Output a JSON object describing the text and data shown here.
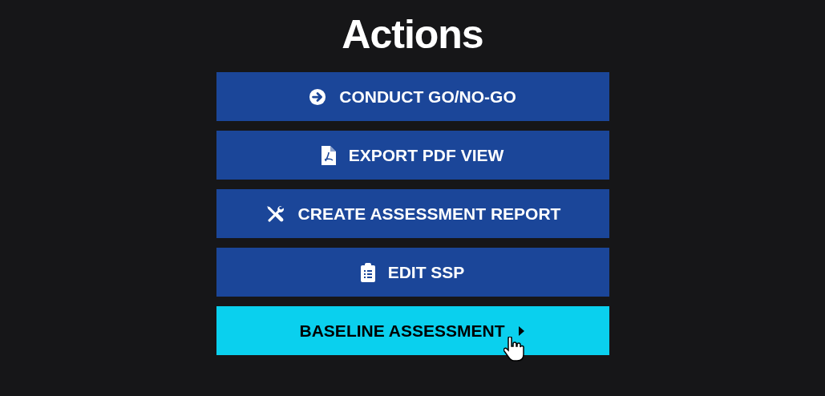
{
  "title": "Actions",
  "actions": [
    {
      "label": "CONDUCT GO/NO-GO",
      "kind": "go",
      "hovered": false
    },
    {
      "label": "EXPORT PDF VIEW",
      "kind": "export",
      "hovered": false
    },
    {
      "label": "CREATE ASSESSMENT REPORT",
      "kind": "report",
      "hovered": false
    },
    {
      "label": "EDIT SSP",
      "kind": "edit",
      "hovered": false
    },
    {
      "label": "BASELINE ASSESSMENT",
      "kind": "submenu",
      "hovered": true
    }
  ]
}
